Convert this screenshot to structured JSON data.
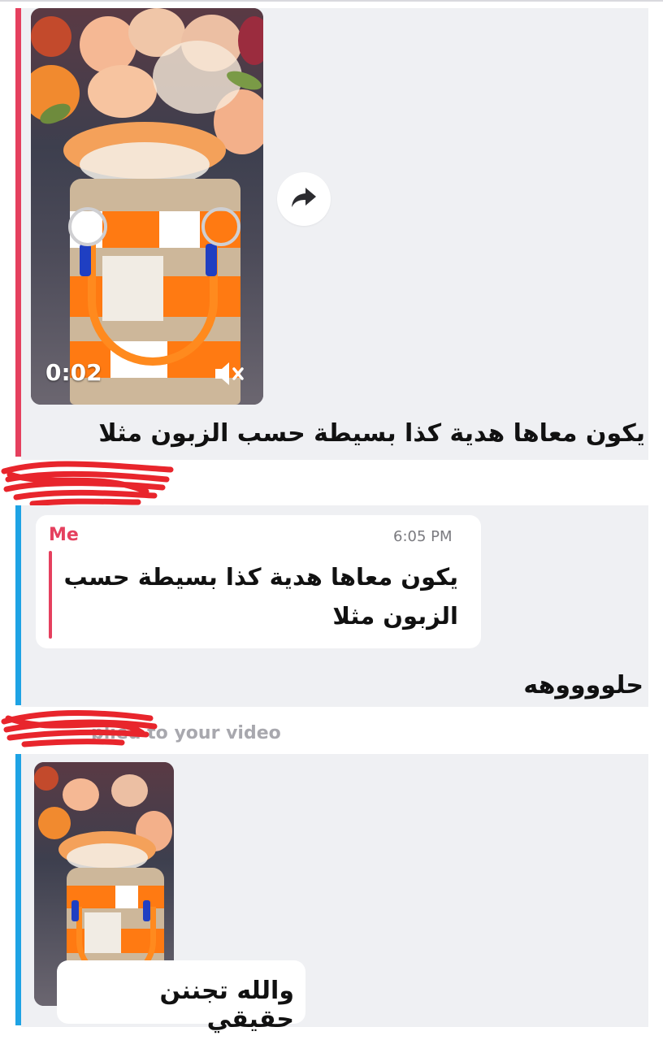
{
  "messages": [
    {
      "video": {
        "duration": "0:02"
      },
      "caption": "يكون معاها هدية كذا بسيطة حسب الزبون مثلا"
    },
    {
      "quote": {
        "sender": "Me",
        "time": "6:05 PM",
        "text": "يكون معاها هدية كذا بسيطة حسب الزبون مثلا"
      },
      "reply": "حلووووهه"
    },
    {
      "notice": "plied to your video",
      "caption": "والله تجننن حقيقي"
    }
  ],
  "colors": {
    "incoming_accent": "#e5405e",
    "outgoing_accent": "#1ea3e4",
    "bubble_bg": "#eff0f3",
    "redaction": "#e8252c"
  },
  "icons": {
    "forward": "forward-arrow-icon",
    "mute": "speaker-muted-icon"
  }
}
